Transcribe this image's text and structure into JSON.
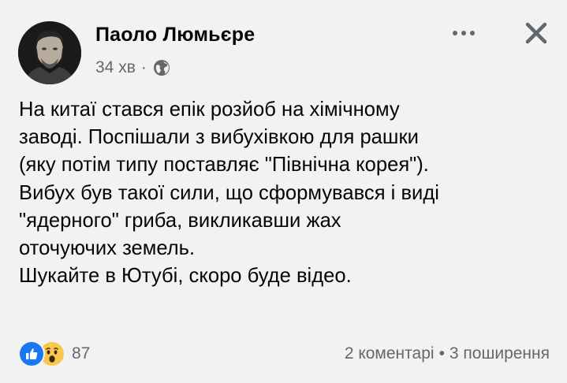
{
  "author": {
    "name": "Паоло Люмьєре",
    "time": "34 хв",
    "separator": "·"
  },
  "icons": {
    "privacy": "globe-icon",
    "more": "more-options-icon",
    "close": "close-icon",
    "reaction_1": "like-icon",
    "reaction_2": "wow-icon"
  },
  "post": {
    "lines": [
      "На китаї стався епік розйоб на хімічному",
      "заводі. Поспішали з вибухівкою для рашки",
      "(яку потім типу поставляє \"Північна корея\").",
      "Вибух був такої сили, що сформувався і виді",
      "\"ядерного\" гриба, викликавши жах",
      "оточуючих земель.",
      "Шукайте в Ютубі, скоро буде відео."
    ]
  },
  "footer": {
    "reaction_count": "87",
    "comments": "2 коментарі",
    "separator": "•",
    "shares": "3 поширення"
  },
  "colors": {
    "background": "#f2f2f2",
    "text": "#050505",
    "secondary": "#65676b",
    "like_blue": "#1877f2",
    "wow_yellow": "#f7c84a"
  }
}
